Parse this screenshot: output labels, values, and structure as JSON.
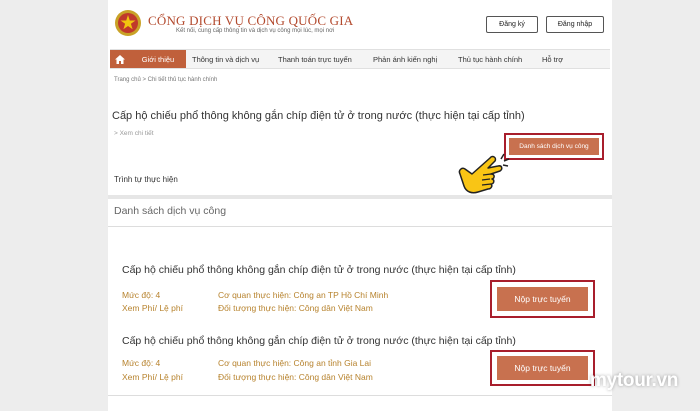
{
  "header": {
    "title": "CỔNG DỊCH VỤ CÔNG QUỐC GIA",
    "subtitle": "Kết nối, cung cấp thông tin và dịch vụ công mọi lúc, mọi nơi",
    "register_label": "Đăng ký",
    "login_label": "Đăng nhập"
  },
  "nav": {
    "items": [
      {
        "label": "Giới thiệu"
      },
      {
        "label": "Thông tin và dịch vụ"
      },
      {
        "label": "Thanh toán trực tuyến"
      },
      {
        "label": "Phản ánh kiến nghị"
      },
      {
        "label": "Thủ tục hành chính"
      },
      {
        "label": "Hỗ trợ"
      }
    ]
  },
  "breadcrumb": "Trang chủ  >  Chi tiết thủ tục hành chính",
  "procedure": {
    "title": "Cấp hộ chiếu phổ thông không gắn chíp điện tử ở trong nước (thực hiện tại cấp tỉnh)",
    "view_detail": ">  Xem chi tiết",
    "list_button": "Danh sách dịch vụ công",
    "step_label": "Trình tự thực hiện"
  },
  "services": {
    "section_title": "Danh sách dịch vụ công",
    "items": [
      {
        "title": "Cấp hộ chiếu phổ thông không gắn chíp điện tử ở trong nước (thực hiện tại cấp tỉnh)",
        "level": "Mức độ: 4",
        "fee": "Xem Phí/ Lệ phí",
        "agency": "Cơ quan thực hiện: Công an TP Hồ Chí Minh",
        "target": "Đối tượng thực hiện: Công dân Việt Nam",
        "submit_label": "Nộp trực tuyến"
      },
      {
        "title": "Cấp hộ chiếu phổ thông không gắn chíp điện tử ở trong nước (thực hiện tại cấp tỉnh)",
        "level": "Mức độ: 4",
        "fee": "Xem Phí/ Lệ phí",
        "agency": "Cơ quan thực hiện: Công an tỉnh Gia Lai",
        "target": "Đối tượng thực hiện: Công dân Việt Nam",
        "submit_label": "Nộp trực tuyến"
      }
    ]
  },
  "watermark": "mytour.vn",
  "colors": {
    "accent": "#c0603b",
    "highlight": "#a81e2c",
    "meta_text": "#b7832e"
  }
}
